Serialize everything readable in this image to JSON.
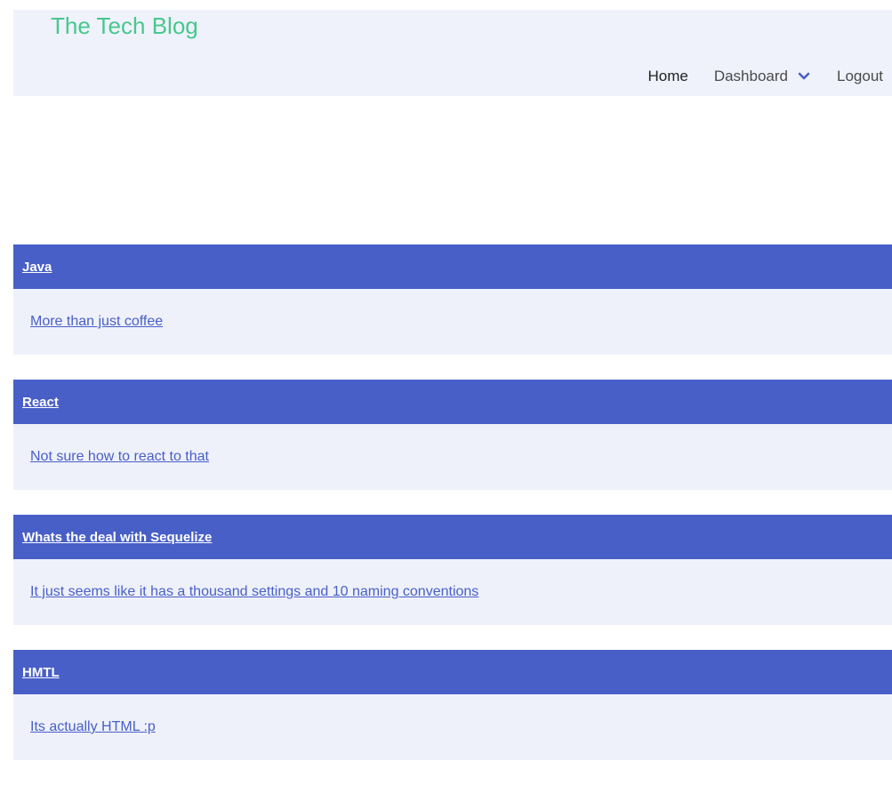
{
  "navbar": {
    "brand": "The Tech Blog",
    "items": [
      {
        "label": "Home"
      },
      {
        "label": "Dashboard"
      },
      {
        "label": "Logout"
      }
    ]
  },
  "posts": [
    {
      "title": "Java",
      "summary": "More than just coffee"
    },
    {
      "title": "React",
      "summary": "Not sure how to react to that"
    },
    {
      "title": "Whats the deal with Sequelize",
      "summary": "It just seems like it has a thousand settings and 10 naming conventions"
    },
    {
      "title": "HMTL",
      "summary": "Its actually HTML :p"
    }
  ],
  "colors": {
    "brand": "#48c78e",
    "accent": "#485fc7",
    "navbar_bg": "#eff2fa",
    "card_body_bg": "#eff1fa"
  }
}
